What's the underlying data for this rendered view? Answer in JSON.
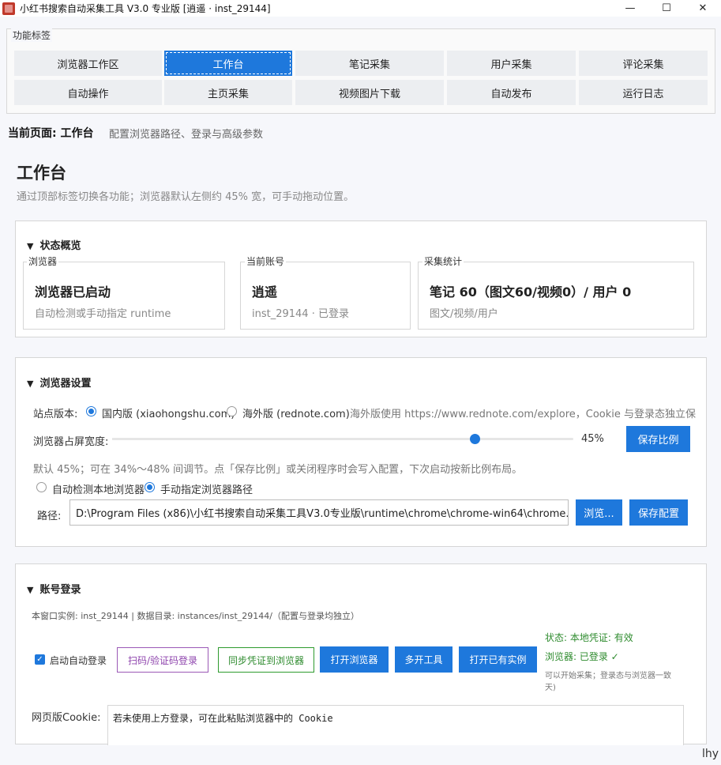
{
  "window": {
    "title": "小红书搜索自动采集工具 V3.0 专业版  [逍遥 · inst_29144]",
    "minimize": "—",
    "maximize": "☐",
    "close": "✕"
  },
  "tabs_group": {
    "legend": "功能标签",
    "row1": [
      "浏览器工作区",
      "工作台",
      "笔记采集",
      "用户采集",
      "评论采集"
    ],
    "row2": [
      "自动操作",
      "主页采集",
      "视频图片下载",
      "自动发布",
      "运行日志"
    ],
    "active": "工作台"
  },
  "current_page": {
    "label": "当前页面: 工作台",
    "desc": "配置浏览器路径、登录与高级参数"
  },
  "heading": {
    "title": "工作台",
    "subtitle": "通过顶部标签切换各功能；浏览器默认左侧约 45% 宽，可手动拖动位置。"
  },
  "status": {
    "title": "状态概览",
    "cards": [
      {
        "label": "浏览器",
        "value": "浏览器已启动",
        "sub": "自动检测或手动指定 runtime"
      },
      {
        "label": "当前账号",
        "value": "逍遥",
        "sub": "inst_29144 · 已登录"
      },
      {
        "label": "采集统计",
        "value": "笔记 60（图文60/视频0）/ 用户 0",
        "sub": "图文/视频/用户"
      }
    ]
  },
  "browser": {
    "title": "浏览器设置",
    "site_label": "站点版本:",
    "site_domestic": "国内版 (xiaohongshu.com)",
    "site_overseas": "海外版 (rednote.com)",
    "site_note": "海外版使用 https://www.rednote.com/explore，Cookie 与登录态独立保",
    "width_label": "浏览器占屏宽度:",
    "width_value": "45%",
    "width_percent": 45,
    "save_ratio": "保存比例",
    "width_hint": "默认 45%；可在 34%～48% 间调节。点「保存比例」或关闭程序时会写入配置，下次启动按新比例布局。",
    "auto_detect": "自动检测本地浏览器",
    "manual_path": "手动指定浏览器路径",
    "path_label": "路径:",
    "path_value": "D:\\Program Files (x86)\\小红书搜索自动采集工具V3.0专业版\\runtime\\chrome\\chrome-win64\\chrome.exe",
    "browse": "浏览...",
    "save_config": "保存配置"
  },
  "account": {
    "title": "账号登录",
    "instance_info": "本窗口实例: inst_29144  |  数据目录: instances/inst_29144/（配置与登录均独立）",
    "auto_login": "启动自动登录",
    "btn_qr": "扫码/验证码登录",
    "btn_sync": "同步凭证到浏览器",
    "btn_open_browser": "打开浏览器",
    "btn_multi": "多开工具",
    "btn_open_instance": "打开已有实例",
    "state_line": "状态: 本地凭证: 有效",
    "browser_line": "浏览器: 已登录 ✓",
    "ready_line1": "可以开始采集；登录态与浏览器一致",
    "ready_line2": "天)",
    "cookie_label": "网页版Cookie:",
    "cookie_text": "若未使用上方登录，可在此粘贴浏览器中的 Cookie"
  },
  "corner_text": "lhy"
}
